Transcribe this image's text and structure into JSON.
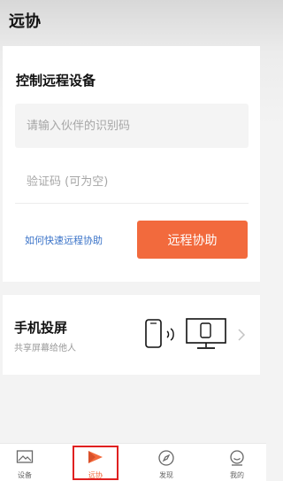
{
  "page": {
    "title": "远协"
  },
  "remote_card": {
    "title": "控制远程设备",
    "id_placeholder": "请输入伙伴的识别码",
    "code_placeholder": "验证码 (可为空)",
    "help_link": "如何快速远程协助",
    "assist_button": "远程协助"
  },
  "mirror_card": {
    "title": "手机投屏",
    "subtitle": "共享屏幕给他人"
  },
  "tabbar": {
    "tabs": [
      {
        "label": "设备",
        "icon": "device-image-icon",
        "active": false
      },
      {
        "label": "远协",
        "icon": "remote-assist-icon",
        "active": true
      },
      {
        "label": "发现",
        "icon": "compass-icon",
        "active": false
      },
      {
        "label": "我的",
        "icon": "profile-icon",
        "active": false
      }
    ]
  },
  "colors": {
    "accent": "#f26a3d",
    "link": "#3a73c8",
    "highlight_box": "#e02020"
  }
}
